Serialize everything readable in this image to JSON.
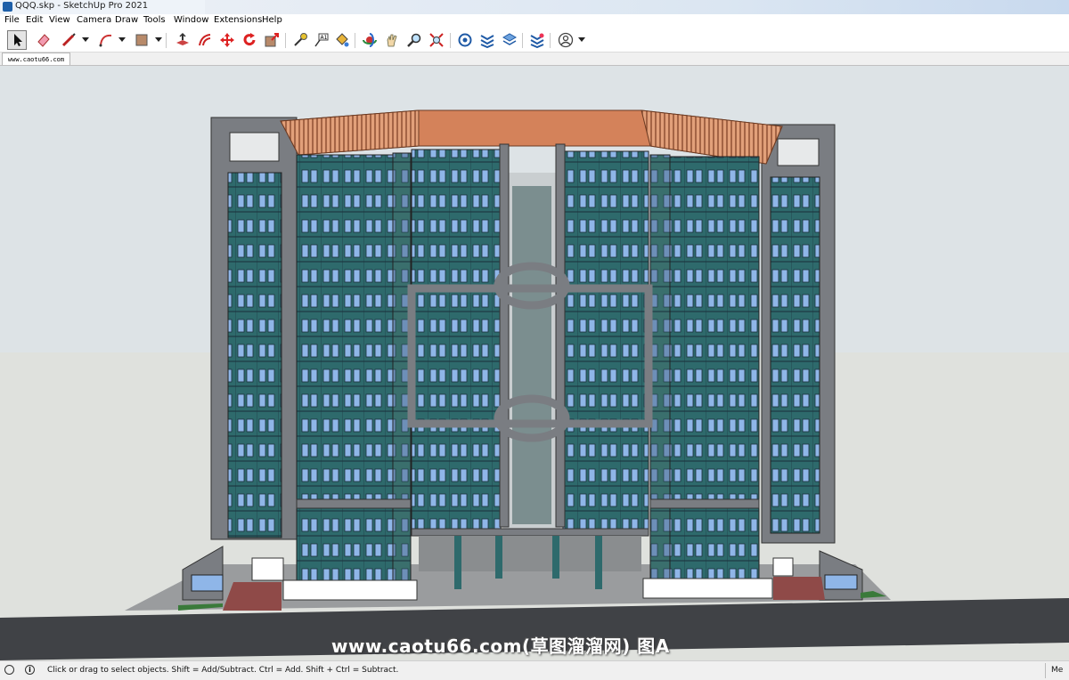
{
  "window": {
    "title": "QQQ.skp - SketchUp Pro 2021"
  },
  "menu": [
    "File",
    "Edit",
    "View",
    "Camera",
    "Draw",
    "Tools",
    "Window",
    "Extensions",
    "Help"
  ],
  "toolbar": {
    "tools": [
      {
        "name": "select-icon"
      },
      {
        "name": "eraser-icon"
      },
      {
        "name": "line-icon"
      },
      {
        "name": "arc-icon"
      },
      {
        "name": "rectangle-icon"
      },
      {
        "name": "push-pull-icon"
      },
      {
        "name": "offset-icon"
      },
      {
        "name": "move-icon"
      },
      {
        "name": "rotate-icon"
      },
      {
        "name": "scale-icon"
      },
      {
        "name": "tape-measure-icon"
      },
      {
        "name": "text-icon"
      },
      {
        "name": "paint-bucket-icon"
      },
      {
        "name": "orbit-icon"
      },
      {
        "name": "pan-icon"
      },
      {
        "name": "zoom-icon"
      },
      {
        "name": "zoom-extents-icon"
      },
      {
        "name": "3d-warehouse-icon"
      },
      {
        "name": "extension-warehouse-icon"
      },
      {
        "name": "layout-icon"
      },
      {
        "name": "extension-manager-icon"
      },
      {
        "name": "account-icon"
      }
    ]
  },
  "scene_tab": {
    "label": "www.caotu66.com"
  },
  "viewport": {
    "watermark": "www.caotu66.com(草图溜溜网) 图A"
  },
  "status": {
    "hint": "Click or drag to select objects. Shift = Add/Subtract. Ctrl = Add. Shift + Ctrl = Subtract.",
    "right": "Me"
  },
  "colors": {
    "sky": "#dde3e6",
    "ground": "#dfe1dd",
    "glass": "#2e6a6c",
    "frame": "#7a7d82",
    "roof": "#d4825a",
    "road": "#404246"
  }
}
